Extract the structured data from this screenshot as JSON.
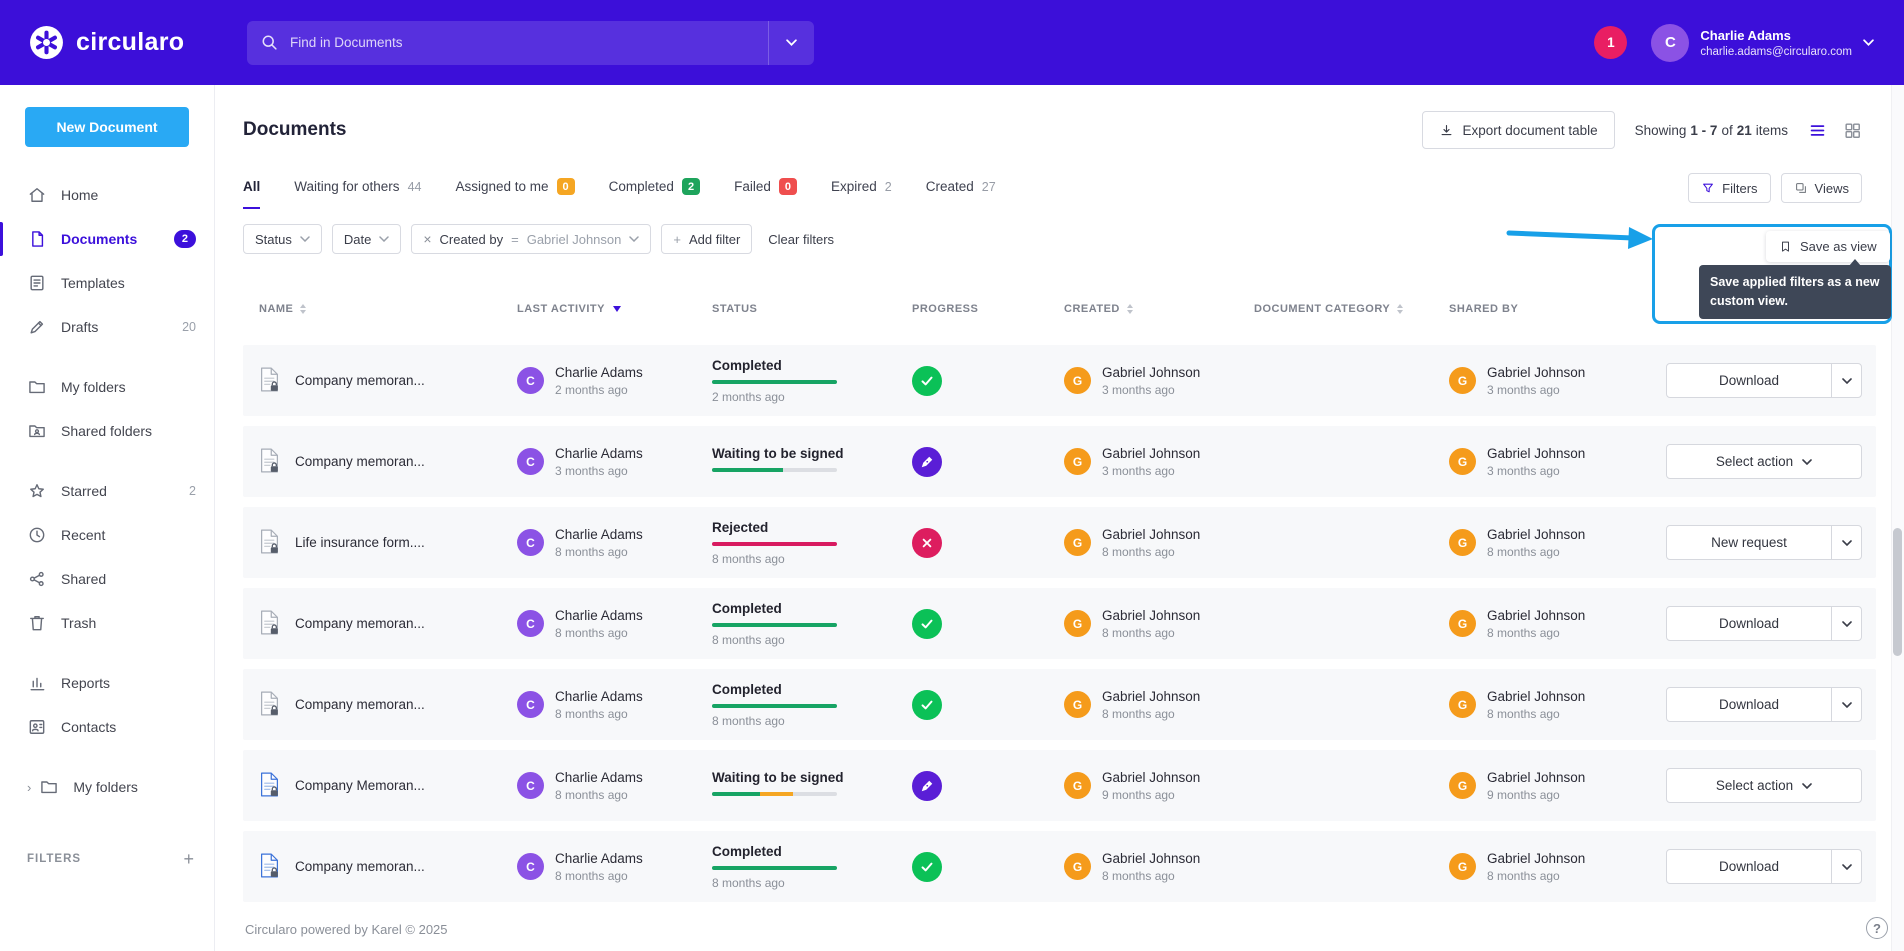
{
  "topbar": {
    "brand": "circularo",
    "search_placeholder": "Find in Documents",
    "notification_count": "1",
    "user_name": "Charlie Adams",
    "user_email": "charlie.adams@circularo.com",
    "user_initial": "C"
  },
  "sidebar": {
    "new_document": "New Document",
    "items": [
      {
        "label": "Home",
        "icon": "home"
      },
      {
        "label": "Documents",
        "icon": "file",
        "badge": "2",
        "badge_style": "purple",
        "active": true
      },
      {
        "label": "Templates",
        "icon": "template"
      },
      {
        "label": "Drafts",
        "icon": "draft",
        "badge": "20",
        "badge_style": "plain"
      },
      {
        "label": "My folders",
        "icon": "folder",
        "group_start": true
      },
      {
        "label": "Shared folders",
        "icon": "folder-shared"
      },
      {
        "label": "Starred",
        "icon": "star",
        "badge": "2",
        "badge_style": "plain",
        "group_start": true
      },
      {
        "label": "Recent",
        "icon": "clock"
      },
      {
        "label": "Shared",
        "icon": "share"
      },
      {
        "label": "Trash",
        "icon": "trash"
      },
      {
        "label": "Reports",
        "icon": "chart",
        "group_start": true
      },
      {
        "label": "Contacts",
        "icon": "contacts"
      },
      {
        "label": "My folders",
        "icon": "folder",
        "group_start": true,
        "expandable": true
      }
    ],
    "filters_label": "FILTERS"
  },
  "main": {
    "title": "Documents",
    "export_button": "Export document table",
    "showing": {
      "prefix": "Showing",
      "range": "1 - 7",
      "of": "of",
      "total": "21",
      "items": "items"
    },
    "tabs": [
      {
        "label": "All",
        "active": true
      },
      {
        "label": "Waiting for others",
        "count": "44",
        "count_style": "plain"
      },
      {
        "label": "Assigned to me",
        "count": "0",
        "count_style": "orange"
      },
      {
        "label": "Completed",
        "count": "2",
        "count_style": "green"
      },
      {
        "label": "Failed",
        "count": "0",
        "count_style": "red"
      },
      {
        "label": "Expired",
        "count": "2",
        "count_style": "plain"
      },
      {
        "label": "Created",
        "count": "27",
        "count_style": "plain"
      }
    ],
    "filters_button": "Filters",
    "views_button": "Views",
    "filter_bar": {
      "status_dropdown": "Status",
      "date_dropdown": "Date",
      "chip_field": "Created by",
      "chip_operator": "=",
      "chip_value": "Gabriel Johnson",
      "add_filter": "Add filter",
      "clear_filters": "Clear filters"
    },
    "save_view": {
      "button": "Save as view",
      "tooltip": "Save applied filters as a new custom view."
    },
    "table": {
      "headers": [
        {
          "label": "NAME",
          "sort": "inactive"
        },
        {
          "label": "LAST ACTIVITY",
          "sort": "desc"
        },
        {
          "label": "STATUS",
          "sort": "none"
        },
        {
          "label": "PROGRESS",
          "sort": "none"
        },
        {
          "label": "CREATED",
          "sort": "inactive"
        },
        {
          "label": "DOCUMENT CATEGORY",
          "sort": "inactive"
        },
        {
          "label": "SHARED BY",
          "sort": "none"
        }
      ],
      "rows": [
        {
          "name": "Company memoran...",
          "doc_icon": "gray",
          "last_activity": {
            "initial": "C",
            "color": "purple",
            "name": "Charlie Adams",
            "time": "2 months ago"
          },
          "status": {
            "label": "Completed",
            "time": "2 months ago"
          },
          "progress_icon": "check",
          "bar": [
            [
              "green",
              100
            ]
          ],
          "created": {
            "initial": "G",
            "color": "orange",
            "name": "Gabriel Johnson",
            "time": "3 months ago"
          },
          "category": "",
          "shared_by": {
            "initial": "G",
            "color": "orange",
            "name": "Gabriel Johnson",
            "time": "3 months ago"
          },
          "action": {
            "label": "Download",
            "split": true
          }
        },
        {
          "name": "Company memoran...",
          "doc_icon": "gray",
          "last_activity": {
            "initial": "C",
            "color": "purple",
            "name": "Charlie Adams",
            "time": "3 months ago"
          },
          "status": {
            "label": "Waiting to be signed",
            "time": ""
          },
          "progress_icon": "pen",
          "bar": [
            [
              "green",
              57
            ]
          ],
          "created": {
            "initial": "G",
            "color": "orange",
            "name": "Gabriel Johnson",
            "time": "3 months ago"
          },
          "category": "",
          "shared_by": {
            "initial": "G",
            "color": "orange",
            "name": "Gabriel Johnson",
            "time": "3 months ago"
          },
          "action": {
            "label": "Select action",
            "split": false
          }
        },
        {
          "name": "Life insurance form....",
          "doc_icon": "gray",
          "last_activity": {
            "initial": "C",
            "color": "purple",
            "name": "Charlie Adams",
            "time": "8 months ago"
          },
          "status": {
            "label": "Rejected",
            "time": "8 months ago"
          },
          "progress_icon": "cross",
          "bar": [
            [
              "crimson",
              100
            ]
          ],
          "created": {
            "initial": "G",
            "color": "orange",
            "name": "Gabriel Johnson",
            "time": "8 months ago"
          },
          "category": "",
          "shared_by": {
            "initial": "G",
            "color": "orange",
            "name": "Gabriel Johnson",
            "time": "8 months ago"
          },
          "action": {
            "label": "New request",
            "split": true
          }
        },
        {
          "name": "Company memoran...",
          "doc_icon": "gray",
          "last_activity": {
            "initial": "C",
            "color": "purple",
            "name": "Charlie Adams",
            "time": "8 months ago"
          },
          "status": {
            "label": "Completed",
            "time": "8 months ago"
          },
          "progress_icon": "check",
          "bar": [
            [
              "green",
              100
            ]
          ],
          "created": {
            "initial": "G",
            "color": "orange",
            "name": "Gabriel Johnson",
            "time": "8 months ago"
          },
          "category": "",
          "shared_by": {
            "initial": "G",
            "color": "orange",
            "name": "Gabriel Johnson",
            "time": "8 months ago"
          },
          "action": {
            "label": "Download",
            "split": true
          }
        },
        {
          "name": "Company memoran...",
          "doc_icon": "gray",
          "last_activity": {
            "initial": "C",
            "color": "purple",
            "name": "Charlie Adams",
            "time": "8 months ago"
          },
          "status": {
            "label": "Completed",
            "time": "8 months ago"
          },
          "progress_icon": "check",
          "bar": [
            [
              "green",
              100
            ]
          ],
          "created": {
            "initial": "G",
            "color": "orange",
            "name": "Gabriel Johnson",
            "time": "8 months ago"
          },
          "category": "",
          "shared_by": {
            "initial": "G",
            "color": "orange",
            "name": "Gabriel Johnson",
            "time": "8 months ago"
          },
          "action": {
            "label": "Download",
            "split": true
          }
        },
        {
          "name": "Company Memoran...",
          "doc_icon": "blue",
          "last_activity": {
            "initial": "C",
            "color": "purple",
            "name": "Charlie Adams",
            "time": "8 months ago"
          },
          "status": {
            "label": "Waiting to be signed",
            "time": ""
          },
          "progress_icon": "pen",
          "bar": [
            [
              "green",
              38
            ],
            [
              "orange",
              27
            ]
          ],
          "created": {
            "initial": "G",
            "color": "orange",
            "name": "Gabriel Johnson",
            "time": "9 months ago"
          },
          "category": "",
          "shared_by": {
            "initial": "G",
            "color": "orange",
            "name": "Gabriel Johnson",
            "time": "9 months ago"
          },
          "action": {
            "label": "Select action",
            "split": false
          }
        },
        {
          "name": "Company memoran...",
          "doc_icon": "blue",
          "last_activity": {
            "initial": "C",
            "color": "purple",
            "name": "Charlie Adams",
            "time": "8 months ago"
          },
          "status": {
            "label": "Completed",
            "time": "8 months ago"
          },
          "progress_icon": "check",
          "bar": [
            [
              "green",
              100
            ]
          ],
          "created": {
            "initial": "G",
            "color": "orange",
            "name": "Gabriel Johnson",
            "time": "8 months ago"
          },
          "category": "",
          "shared_by": {
            "initial": "G",
            "color": "orange",
            "name": "Gabriel Johnson",
            "time": "8 months ago"
          },
          "action": {
            "label": "Download",
            "split": true
          }
        }
      ]
    },
    "footer": "Circularo powered by Karel © 2025",
    "help_label": "?"
  },
  "colors": {
    "accent_purple": "#3C10DB",
    "topbar_purple": "#3C0FD9",
    "new_document_blue": "#29A9F4",
    "annotation_blue": "#18A0E8",
    "bar_green": "#17A464",
    "bar_orange": "#F5A623",
    "bar_crimson": "#D81B60",
    "icon_check_green": "#0BC157",
    "icon_pen_purple": "#5A1ED6",
    "icon_cross_crimson": "#DD1D5F",
    "avatar_purple": "#8B52E5",
    "avatar_orange": "#F59B1B",
    "notification_pink": "#E91E63",
    "badge_orange": "#F5A623",
    "badge_green": "#1EA45C",
    "badge_red": "#EF4E4E"
  }
}
